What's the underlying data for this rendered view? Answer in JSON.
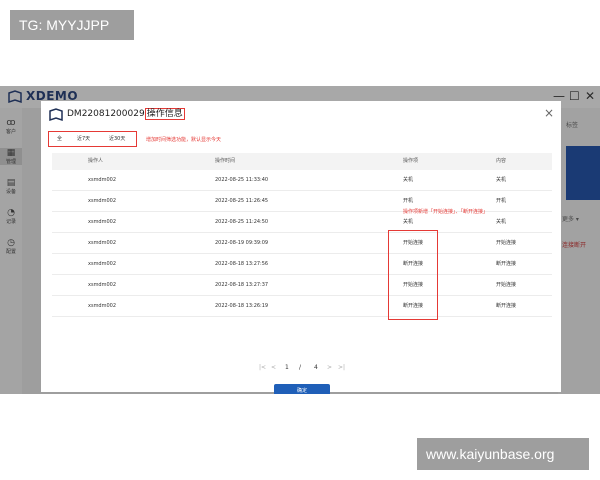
{
  "watermarks": {
    "top": "TG: MYYJJPP",
    "bottom": "www.kaiyunbase.org"
  },
  "app": {
    "name": "XDEMO",
    "window_buttons": [
      "—",
      "☐",
      "✕"
    ],
    "side_nav": [
      "客户",
      "管理",
      "设备",
      "记录",
      "配置"
    ],
    "right_panel_text": [
      "标签",
      "更多 ▾",
      "连接断开"
    ]
  },
  "dialog": {
    "title_id": "DM22081200029",
    "title_label": "操作信息",
    "close": "×",
    "filters": {
      "all": "全",
      "last7": "近7天",
      "last30": "近30天"
    },
    "notes": {
      "filter": "增加时间筛选功能，默认显示今天",
      "ops": "操作项新增「开始连接」、「断开连接」"
    },
    "columns": [
      "操作人",
      "操作时间",
      "操作项",
      "内容"
    ],
    "rows": [
      {
        "user": "xsmdm002",
        "time": "2022-08-25 11:33:40",
        "op": "关机",
        "content": "关机"
      },
      {
        "user": "xsmdm002",
        "time": "2022-08-25 11:26:45",
        "op": "开机",
        "content": "开机"
      },
      {
        "user": "xsmdm002",
        "time": "2022-08-25 11:24:50",
        "op": "关机",
        "content": "关机"
      },
      {
        "user": "xsmdm002",
        "time": "2022-08-19 09:39:09",
        "op": "开始连接",
        "content": "开始连接"
      },
      {
        "user": "xsmdm002",
        "time": "2022-08-18 13:27:56",
        "op": "断开连接",
        "content": "断开连接"
      },
      {
        "user": "xsmdm002",
        "time": "2022-08-18 13:27:37",
        "op": "开始连接",
        "content": "开始连接"
      },
      {
        "user": "xsmdm002",
        "time": "2022-08-18 13:26:19",
        "op": "断开连接",
        "content": "断开连接"
      }
    ],
    "pagination": {
      "first": "|<",
      "prev": "<",
      "current": "1",
      "sep": "/",
      "total": "4",
      "next": ">",
      "last": ">|"
    },
    "ok_label": "确定"
  }
}
